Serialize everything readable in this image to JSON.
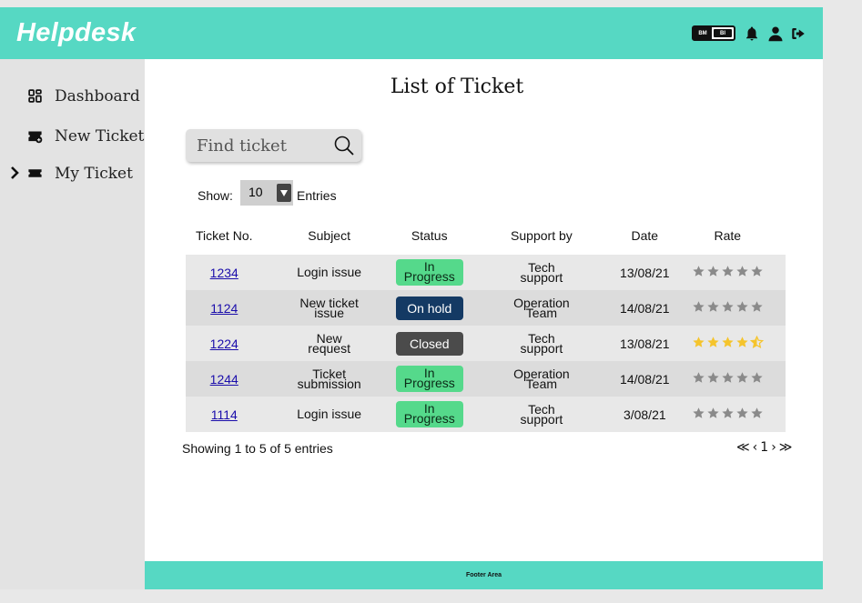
{
  "app": {
    "title": "Helpdesk"
  },
  "header": {
    "lang_left": "BM",
    "lang_right": "BI",
    "icons": [
      "bell-icon",
      "user-icon",
      "logout-icon"
    ]
  },
  "sidebar": {
    "items": [
      {
        "label": "Dashboard",
        "icon": "dashboard-icon",
        "active": false
      },
      {
        "label": "New Ticket",
        "icon": "new-ticket-icon",
        "active": false
      },
      {
        "label": "My Ticket",
        "icon": "ticket-icon",
        "active": true
      }
    ]
  },
  "main": {
    "title": "List of Ticket",
    "search": {
      "placeholder": "Find ticket"
    },
    "show_label": "Show:",
    "show_value": "10",
    "entries_label": "Entries",
    "columns": [
      "Ticket No.",
      "Subject",
      "Status",
      "Support by",
      "Date",
      "Rate"
    ],
    "rows": [
      {
        "id": "1234",
        "subject": [
          "Login issue"
        ],
        "status": [
          "In",
          "Progress"
        ],
        "status_type": "progress",
        "support": [
          "Tech",
          "support"
        ],
        "date": "13/08/21",
        "rating": 0
      },
      {
        "id": "1124",
        "subject": [
          "New ticket",
          "issue"
        ],
        "status": [
          "On hold"
        ],
        "status_type": "hold",
        "support": [
          "Operation",
          "Team"
        ],
        "date": "14/08/21",
        "rating": 0
      },
      {
        "id": "1224",
        "subject": [
          "New",
          "request"
        ],
        "status": [
          "Closed"
        ],
        "status_type": "closed",
        "support": [
          "Tech",
          "support"
        ],
        "date": "13/08/21",
        "rating": 4.5
      },
      {
        "id": "1244",
        "subject": [
          "Ticket",
          "submission"
        ],
        "status": [
          "In",
          "Progress"
        ],
        "status_type": "progress",
        "support": [
          "Operation",
          "Team"
        ],
        "date": "14/08/21",
        "rating": 0
      },
      {
        "id": "1114",
        "subject": [
          "Login issue"
        ],
        "status": [
          "In",
          "Progress"
        ],
        "status_type": "progress",
        "support": [
          "Tech",
          "support"
        ],
        "date": "3/08/21",
        "rating": 0
      }
    ],
    "showing_text": "Showing 1 to 5 of 5 entries",
    "pager": {
      "first": "≪",
      "prev": "‹",
      "page": "1",
      "next": "›",
      "last": "≫"
    }
  },
  "footer": {
    "text": "Footer Area"
  },
  "colors": {
    "accent": "#56d8c3",
    "progress": "#55d98b",
    "hold": "#143a64",
    "closed": "#4b4b4b",
    "star_on": "#f5c42c",
    "star_off": "#8a8a8a"
  }
}
